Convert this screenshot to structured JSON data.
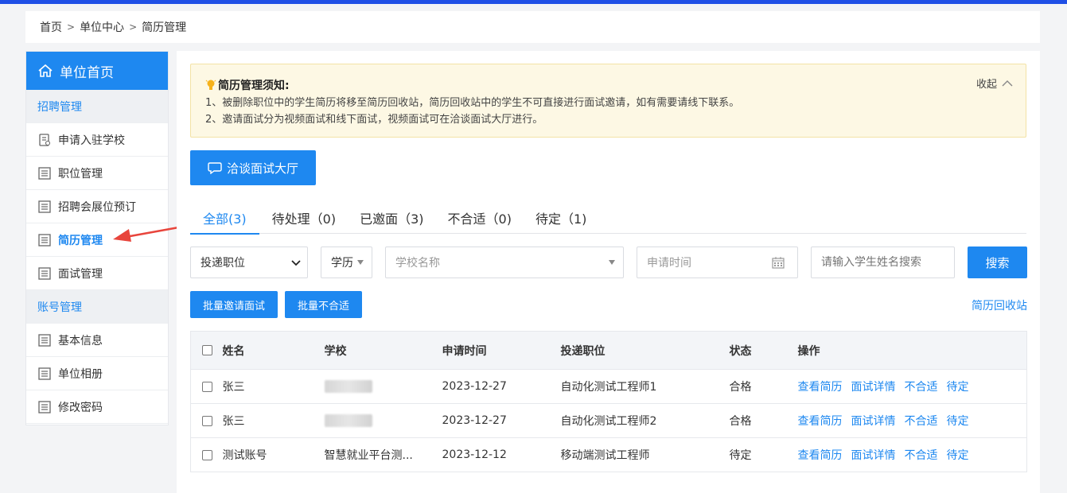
{
  "breadcrumb": [
    "首页",
    "单位中心",
    "简历管理"
  ],
  "sidebar": {
    "home": "单位首页",
    "groups": [
      {
        "title": "招聘管理",
        "items": [
          "申请入驻学校",
          "职位管理",
          "招聘会展位预订",
          "简历管理",
          "面试管理"
        ]
      },
      {
        "title": "账号管理",
        "items": [
          "基本信息",
          "单位相册",
          "修改密码"
        ]
      }
    ],
    "active": "简历管理"
  },
  "notice": {
    "title": "简历管理须知:",
    "lines": [
      "1、被删除职位中的学生简历将移至简历回收站，简历回收站中的学生不可直接进行面试邀请，如有需要请线下联系。",
      "2、邀请面试分为视频面试和线下面试，视频面试可在洽谈面试大厅进行。"
    ],
    "collapse": "收起"
  },
  "hall_button": "洽谈面试大厅",
  "tabs": [
    "全部(3)",
    "待处理（0)",
    "已邀面（3)",
    "不合适（0)",
    "待定（1)"
  ],
  "filters": {
    "position": "投递职位",
    "education": "学历",
    "school_placeholder": "学校名称",
    "date_placeholder": "申请时间",
    "name_placeholder": "请输入学生姓名搜索",
    "search": "搜索"
  },
  "batch": {
    "invite": "批量邀请面试",
    "reject": "批量不合适",
    "recycle": "简历回收站"
  },
  "table": {
    "headers": [
      "姓名",
      "学校",
      "申请时间",
      "投递职位",
      "状态",
      "操作"
    ],
    "rows": [
      {
        "name": "张三",
        "school": "",
        "date": "2023-12-27",
        "position": "自动化测试工程师1",
        "status": "合格"
      },
      {
        "name": "张三",
        "school": "",
        "date": "2023-12-27",
        "position": "自动化测试工程师2",
        "status": "合格"
      },
      {
        "name": "测试账号",
        "school": "智慧就业平台测...",
        "date": "2023-12-12",
        "position": "移动端测试工程师",
        "status": "待定"
      }
    ],
    "actions": [
      "查看简历",
      "面试详情",
      "不合适",
      "待定"
    ]
  },
  "colors": {
    "accent": "#1e88f0",
    "top_bar": "#1f4fe6",
    "notice_bg": "#fdf8e4",
    "arrow": "#e8453c"
  }
}
